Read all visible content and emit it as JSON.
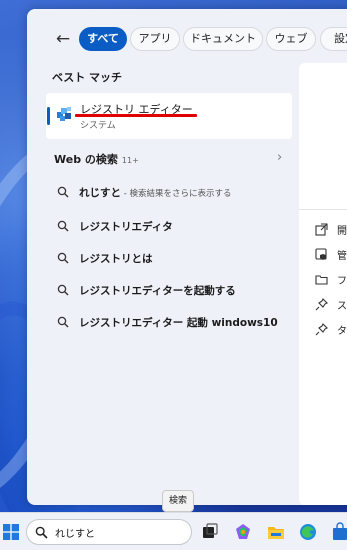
{
  "filters": {
    "back_label": "←",
    "all": "すべて",
    "apps": "アプリ",
    "documents": "ドキュメント",
    "web": "ウェブ",
    "settings": "設定"
  },
  "best_match": {
    "title": "ベスト マッチ",
    "app_name": "レジストリ エディター",
    "app_type": "システム"
  },
  "web_section": {
    "title": "Web の検索",
    "count": "11+",
    "chevron": "›"
  },
  "suggestions": [
    {
      "bold": "れじすと",
      "sub": " - 検索結果をさらに表示する"
    },
    {
      "bold": "レジストリエディタ",
      "sub": ""
    },
    {
      "bold": "レジストリとは",
      "sub": ""
    },
    {
      "bold": "レジストリエディターを起動する",
      "sub": ""
    },
    {
      "bold": "レジストリエディター 起動 windows10",
      "sub": ""
    }
  ],
  "preview_actions": [
    {
      "icon": "open-icon",
      "text": "開"
    },
    {
      "icon": "admin-shield-icon",
      "text": "管"
    },
    {
      "icon": "folder-icon",
      "text": "フ"
    },
    {
      "icon": "pin-icon",
      "text": "ス"
    },
    {
      "icon": "pin-icon",
      "text": "タ"
    }
  ],
  "taskbar": {
    "tooltip": "検索",
    "search_value": "れじすと"
  },
  "colors": {
    "accent": "#0b5cc4",
    "highlight_underline": "#e00000"
  }
}
